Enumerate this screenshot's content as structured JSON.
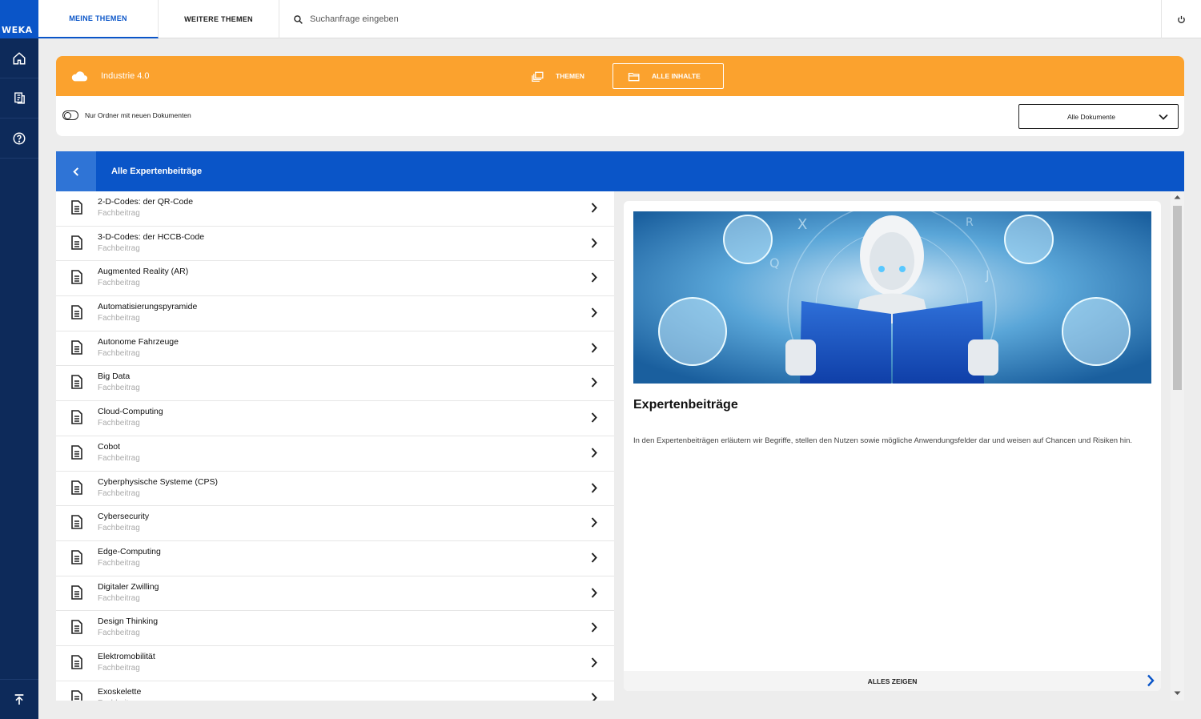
{
  "brand": {
    "logo_text": "WEKA"
  },
  "sidebar": [
    {
      "name": "home-icon"
    },
    {
      "name": "documents-icon"
    },
    {
      "name": "help-icon"
    },
    {
      "name": "scroll-top-icon"
    }
  ],
  "topbar": {
    "tabs": [
      {
        "label": "MEINE THEMEN",
        "active": true
      },
      {
        "label": "WEITERE THEMEN",
        "active": false
      }
    ],
    "search_placeholder": "Suchanfrage eingeben",
    "power_icon": "power-icon"
  },
  "header": {
    "topic": "Industrie 4.0",
    "segments": [
      {
        "label": "THEMEN",
        "icon": "themen-icon",
        "selected": false
      },
      {
        "label": "ALLE INHALTE",
        "icon": "folder-icon",
        "selected": true
      }
    ],
    "toggle_label": "Nur Ordner mit neuen Dokumenten",
    "dropdown_value": "Alle Dokumente",
    "accent": "#fba22e"
  },
  "section": {
    "title": "Alle Expertenbeiträge",
    "color": "#0a55c8"
  },
  "items": [
    {
      "title": "2-D-Codes: der QR-Code",
      "sub": "Fachbeitrag"
    },
    {
      "title": "3-D-Codes: der HCCB-Code",
      "sub": "Fachbeitrag"
    },
    {
      "title": "Augmented Reality (AR)",
      "sub": "Fachbeitrag"
    },
    {
      "title": "Automatisierungspyramide",
      "sub": "Fachbeitrag"
    },
    {
      "title": "Autonome Fahrzeuge",
      "sub": "Fachbeitrag"
    },
    {
      "title": "Big Data",
      "sub": "Fachbeitrag"
    },
    {
      "title": "Cloud-Computing",
      "sub": "Fachbeitrag"
    },
    {
      "title": "Cobot",
      "sub": "Fachbeitrag"
    },
    {
      "title": "Cyberphysische Systeme (CPS)",
      "sub": "Fachbeitrag"
    },
    {
      "title": "Cybersecurity",
      "sub": "Fachbeitrag"
    },
    {
      "title": "Edge-Computing",
      "sub": "Fachbeitrag"
    },
    {
      "title": "Digitaler Zwilling",
      "sub": "Fachbeitrag"
    },
    {
      "title": "Design Thinking",
      "sub": "Fachbeitrag"
    },
    {
      "title": "Elektromobilität",
      "sub": "Fachbeitrag"
    },
    {
      "title": "Exoskelette",
      "sub": "Fachbeitrag"
    }
  ],
  "detail": {
    "title": "Expertenbeiträge",
    "description": "In den Expertenbeiträgen erläutern wir Begriffe, stellen den Nutzen sowie mögliche Anwendungsfelder dar und weisen auf Chancen und Risiken hin.",
    "show_all": "ALLES ZEIGEN"
  }
}
